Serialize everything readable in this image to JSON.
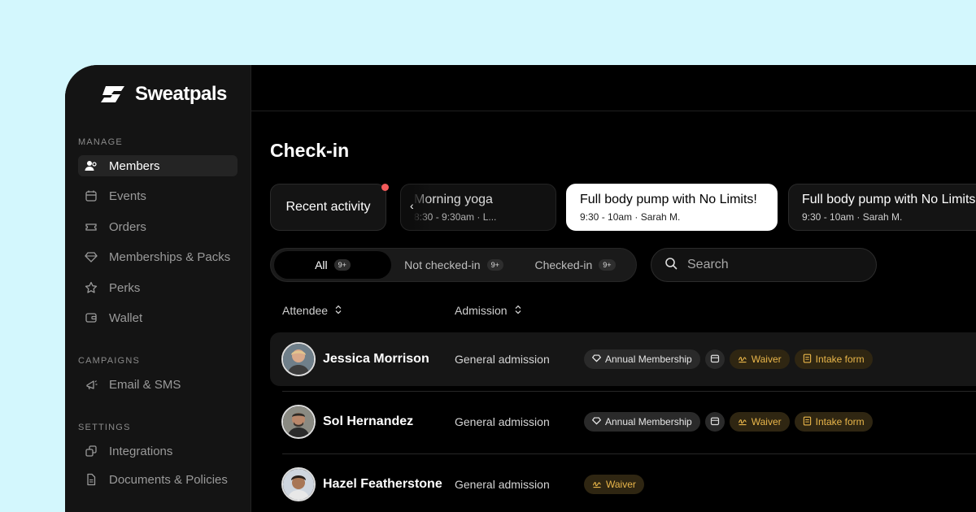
{
  "app": {
    "name": "Sweatpals"
  },
  "sidebar": {
    "sections": [
      {
        "title": "MANAGE"
      },
      {
        "title": "CAMPAIGNS"
      },
      {
        "title": "SETTINGS"
      }
    ],
    "items": [
      {
        "label": "Members",
        "icon": "members-icon",
        "active": true
      },
      {
        "label": "Events",
        "icon": "calendar-icon"
      },
      {
        "label": "Orders",
        "icon": "ticket-icon"
      },
      {
        "label": "Memberships & Packs",
        "icon": "diamond-icon"
      },
      {
        "label": "Perks",
        "icon": "star-icon"
      },
      {
        "label": "Wallet",
        "icon": "wallet-icon"
      },
      {
        "label": "Email & SMS",
        "icon": "megaphone-icon"
      },
      {
        "label": "Integrations",
        "icon": "integrations-icon"
      },
      {
        "label": "Documents & Policies",
        "icon": "document-icon"
      }
    ]
  },
  "page": {
    "title": "Check-in"
  },
  "sessions": {
    "recent_label": "Recent activity",
    "items": [
      {
        "title": "Morning yoga",
        "subtitle": "8:30 - 9:30am · L..."
      },
      {
        "title": "Full body pump with No Limits!",
        "subtitle": "9:30 - 10am · Sarah M.",
        "selected": true
      },
      {
        "title": "Full body pump with No Limits!",
        "subtitle": "9:30 - 10am · Sarah M."
      }
    ]
  },
  "filters": [
    {
      "label": "All",
      "count": "9+",
      "active": true
    },
    {
      "label": "Not checked-in",
      "count": "9+"
    },
    {
      "label": "Checked-in",
      "count": "9+"
    }
  ],
  "search": {
    "placeholder": "Search"
  },
  "table": {
    "columns": [
      "Attendee",
      "Admission"
    ],
    "rows": [
      {
        "name": "Jessica Morrison",
        "admission": "General admission",
        "tags": [
          "Annual Membership",
          "",
          "Waiver",
          "Intake form"
        ]
      },
      {
        "name": "Sol Hernandez",
        "admission": "General admission",
        "tags": [
          "Annual Membership",
          "",
          "Waiver",
          "Intake form"
        ]
      },
      {
        "name": "Hazel Featherstone",
        "admission": "General admission",
        "tags": [
          "Waiver"
        ]
      }
    ]
  },
  "colors": {
    "background": "#d3f7fd",
    "accent_gold": "#e9b64a",
    "notification": "#f25a5a"
  }
}
